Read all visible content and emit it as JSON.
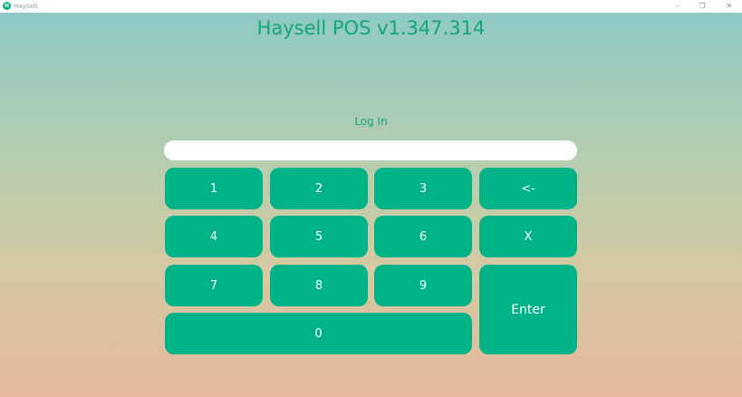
{
  "window": {
    "app_name": "HaySell",
    "logo_letter": "H",
    "controls": {
      "minimize": "–",
      "maximize": "❐",
      "close": "✕"
    }
  },
  "header": {
    "title": "Haysell POS v1.347.314"
  },
  "login": {
    "label": "Log In",
    "pin_value": ""
  },
  "keypad": {
    "k1": "1",
    "k2": "2",
    "k3": "3",
    "backspace": "<-",
    "k4": "4",
    "k5": "5",
    "k6": "6",
    "clear": "X",
    "k7": "7",
    "k8": "8",
    "k9": "9",
    "enter": "Enter",
    "k0": "0"
  },
  "colors": {
    "accent": "#00b386",
    "title_text": "#13a57f",
    "gradient_top": "#8ec9c6",
    "gradient_bottom": "#e6b89c"
  }
}
